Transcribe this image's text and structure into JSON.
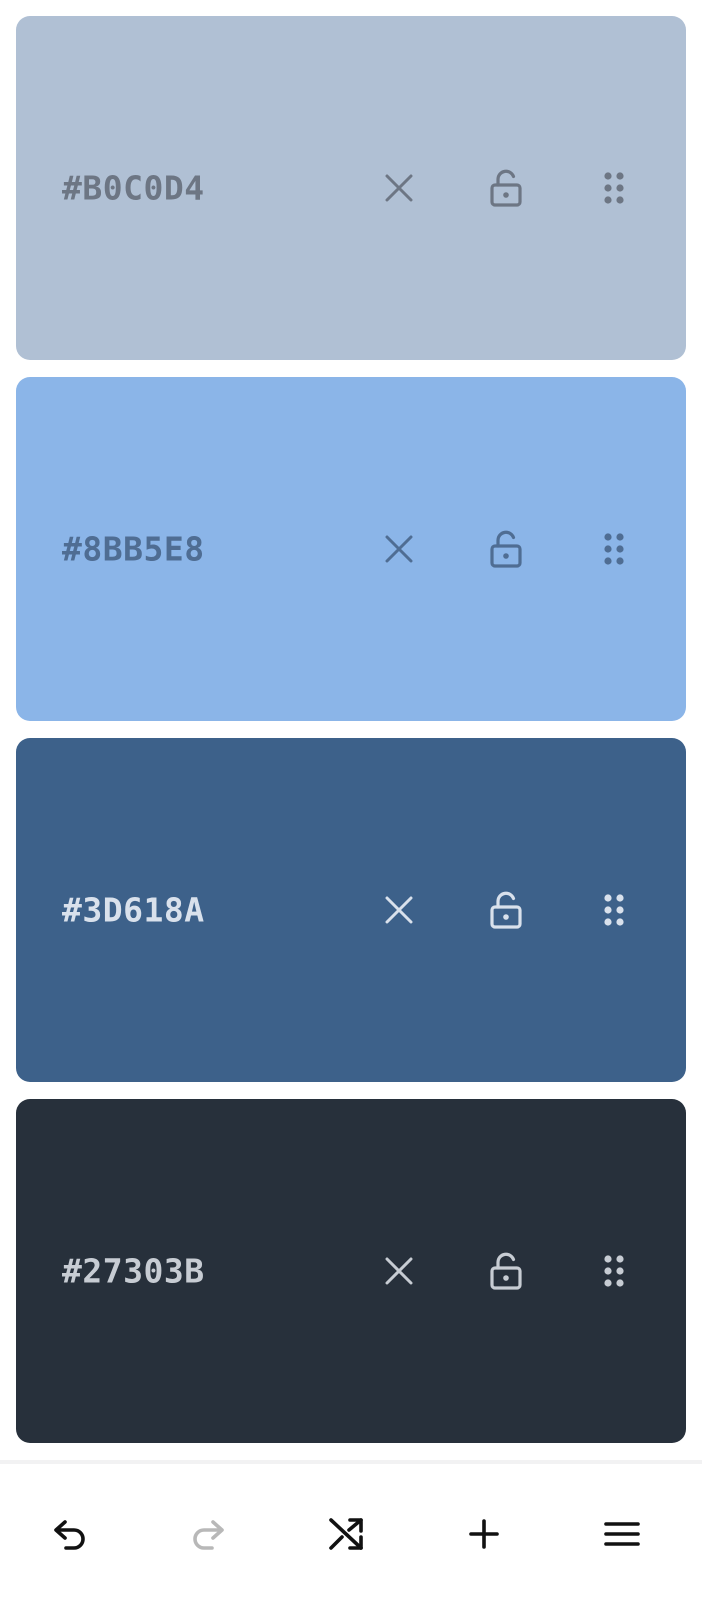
{
  "palette": {
    "swatches": [
      {
        "hex": "#B0C0D4",
        "background": "#B0C0D4",
        "foreground": "#6D7684"
      },
      {
        "hex": "#8BB5E8",
        "background": "#8BB5E8",
        "foreground": "#4F6D93"
      },
      {
        "hex": "#3D618A",
        "background": "#3D618A",
        "foreground": "#D9E1EC"
      },
      {
        "hex": "#27303B",
        "background": "#27303B",
        "foreground": "#C7CCD3"
      }
    ],
    "icons": {
      "remove": "close-icon",
      "lock": "unlock-icon",
      "drag": "drag-handle-icon"
    }
  },
  "toolbar": {
    "undo": {
      "icon": "undo-icon",
      "enabled": true
    },
    "redo": {
      "icon": "redo-icon",
      "enabled": false
    },
    "shuffle": {
      "icon": "shuffle-icon",
      "enabled": true
    },
    "add": {
      "icon": "plus-icon",
      "enabled": true
    },
    "menu": {
      "icon": "menu-icon",
      "enabled": true
    },
    "colors": {
      "enabled": "#111111",
      "disabled": "#B8B8B8"
    }
  }
}
